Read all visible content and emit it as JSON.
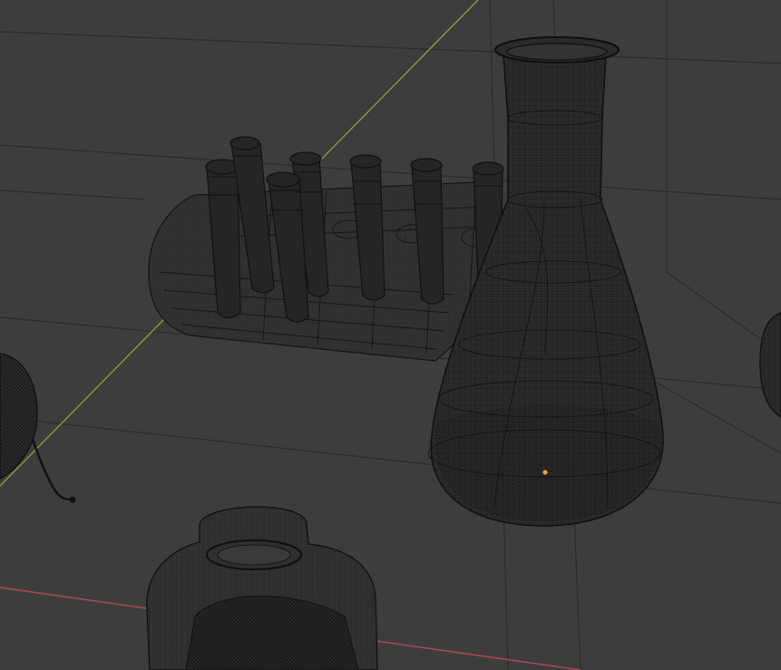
{
  "viewport": {
    "name": "3D Viewport",
    "shading_mode": "wireframe",
    "colors": {
      "background": "#3d3d3d",
      "grid": "#2a2a2a",
      "axis_y": "#7fa33a",
      "axis_x": "#b5475a",
      "wire": "#151515",
      "origin": "#ff9a2e"
    },
    "objects": [
      {
        "id": "erlenmeyer-flask",
        "selected": false
      },
      {
        "id": "test-tube-rack",
        "selected": false
      },
      {
        "id": "test-tube",
        "count": 7
      },
      {
        "id": "jar",
        "selected": false
      },
      {
        "id": "round-flask",
        "selected": false
      },
      {
        "id": "bottle-edge",
        "selected": false
      }
    ]
  }
}
